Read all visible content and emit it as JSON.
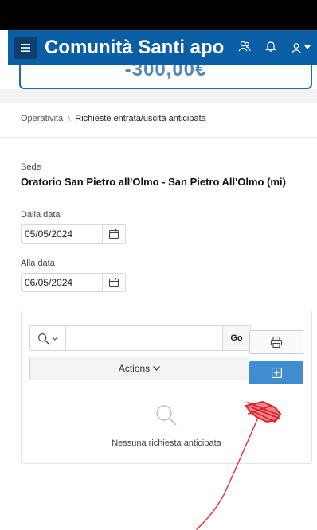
{
  "app": {
    "title": "Comunità Santi apo",
    "menu_icon": "hamburger-icon",
    "header_icons": [
      "group-icon",
      "bell-icon",
      "user-icon",
      "caret-down-icon"
    ]
  },
  "summary": {
    "value": "-300,00€"
  },
  "breadcrumb": {
    "parent": "Operatività",
    "separator": "\\",
    "current": "Richieste entrata/uscita anticipata"
  },
  "form": {
    "sede_label": "Sede",
    "sede_value": "Oratorio San Pietro all'Olmo - San Pietro All'Olmo (mi)",
    "dalla_label": "Dalla data",
    "dalla_value": "05/05/2024",
    "alla_label": "Alla data",
    "alla_value": "06/05/2024"
  },
  "report": {
    "search_value": "",
    "go_label": "Go",
    "actions_label": "Actions",
    "empty_message": "Nessuna richiesta anticipata"
  },
  "colors": {
    "header": "#0a5fa4",
    "primary_button": "#3f8ccf",
    "accent_border": "#1e6bb0",
    "annotation": "#e0202a"
  }
}
